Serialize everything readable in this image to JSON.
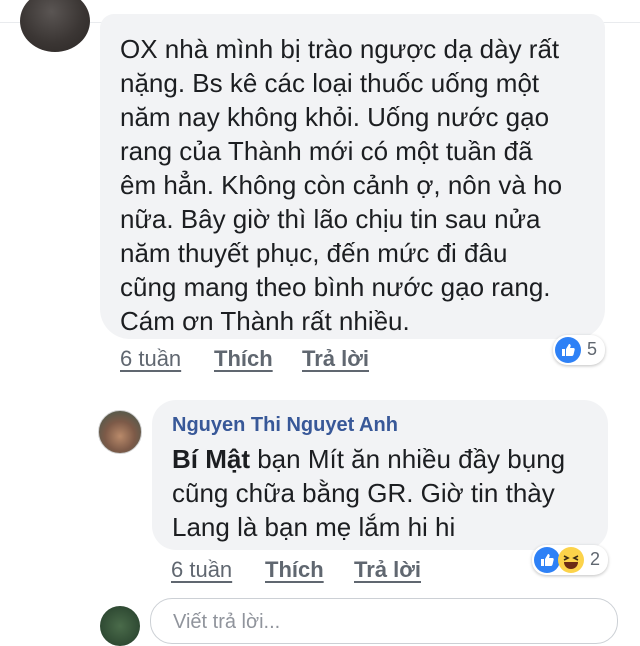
{
  "comment_1": {
    "lines": [
      "OX nhà mình bị trào ngược dạ dày rất",
      "nặng. Bs kê các loại thuốc uống một",
      "năm nay không khỏi. Uống nước gạo",
      "rang của Thành mới có một tuần đã",
      "êm hẳn. Không còn cảnh ợ, nôn và ho",
      "nữa. Bây giờ thì lão chịu tin sau nửa",
      "năm thuyết phục, đến mức đi đâu",
      "cũng mang theo bình nước gạo rang.",
      "Cám ơn Thành rất nhiều."
    ],
    "time": "6 tuần",
    "like_label": "Thích",
    "reply_label": "Trả lời",
    "reaction_count": "5",
    "reactions": [
      "like-icon"
    ]
  },
  "comment_2": {
    "author": "Nguyen Thi Nguyet Anh",
    "mention": "Bí Mật",
    "line1_rest": " bạn Mít ăn nhiều đầy bụng",
    "line2": "cũng chữa bằng GR. Giờ tin thày",
    "line3": "Lang là bạn mẹ lắm hi hi",
    "time": "6 tuần",
    "like_label": "Thích",
    "reply_label": "Trả lời",
    "reaction_count": "2",
    "reactions": [
      "like-icon",
      "haha-icon"
    ]
  },
  "reply_input": {
    "placeholder": "Viết trả lời..."
  },
  "colors": {
    "bubble": "#f2f3f5",
    "author_link": "#385898",
    "like_blue": "#2e81f6",
    "haha_yellow": "#fcd34a",
    "meta_gray": "#606770"
  }
}
